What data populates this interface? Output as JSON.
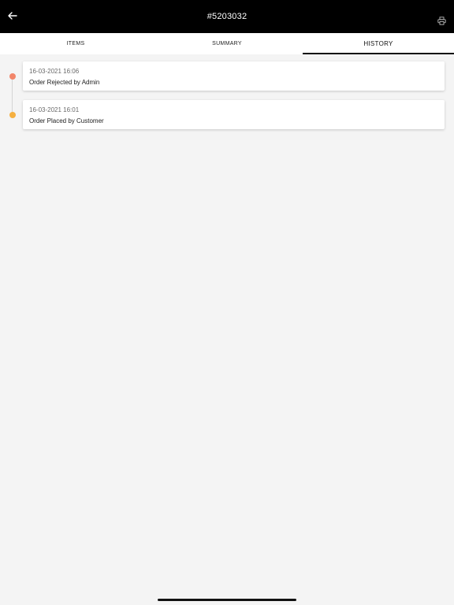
{
  "header": {
    "title": "#5203032",
    "back_icon": "arrow-left-icon",
    "print_icon": "printer-icon"
  },
  "tabs": [
    {
      "label": "ITEMS",
      "active": false
    },
    {
      "label": "SUMMARY",
      "active": false
    },
    {
      "label": "HISTORY",
      "active": true
    }
  ],
  "history": [
    {
      "datetime": "16-03-2021 16:06",
      "event": "Order Rejected by Admin",
      "dot_color": "#f2866a"
    },
    {
      "datetime": "16-03-2021 16:01",
      "event": "Order Placed by Customer",
      "dot_color": "#f5b041"
    }
  ]
}
